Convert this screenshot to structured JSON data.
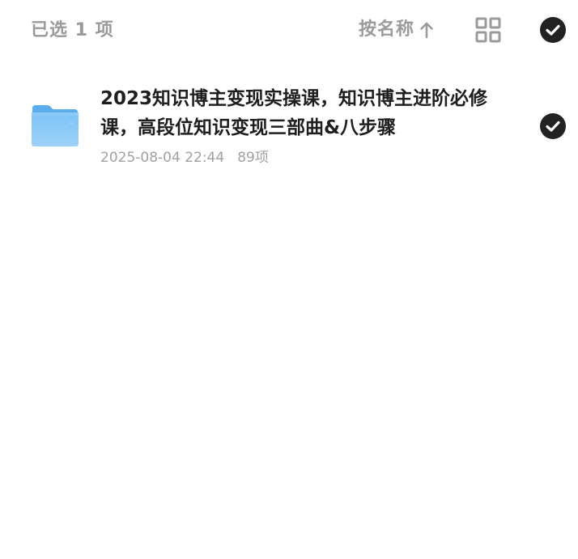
{
  "header": {
    "selected_label": "已选 1 项",
    "sort_label": "按名称",
    "sort_direction_icon": "arrow-up-icon",
    "view_toggle_icon": "grid-view-icon",
    "select_all_icon": "check-circle-icon"
  },
  "files": [
    {
      "name": "2023知识博主变现实操课，知识博主进阶必修课，高段位知识变现三部曲&八步骤",
      "date": "2025-08-04 22:44",
      "count": "89项",
      "icon": "folder-icon",
      "selected": true
    }
  ],
  "colors": {
    "muted_text": "#9a9a9a",
    "title_text": "#1e1e1e",
    "check_fill": "#222222",
    "folder_blue": "#6db8f3"
  }
}
